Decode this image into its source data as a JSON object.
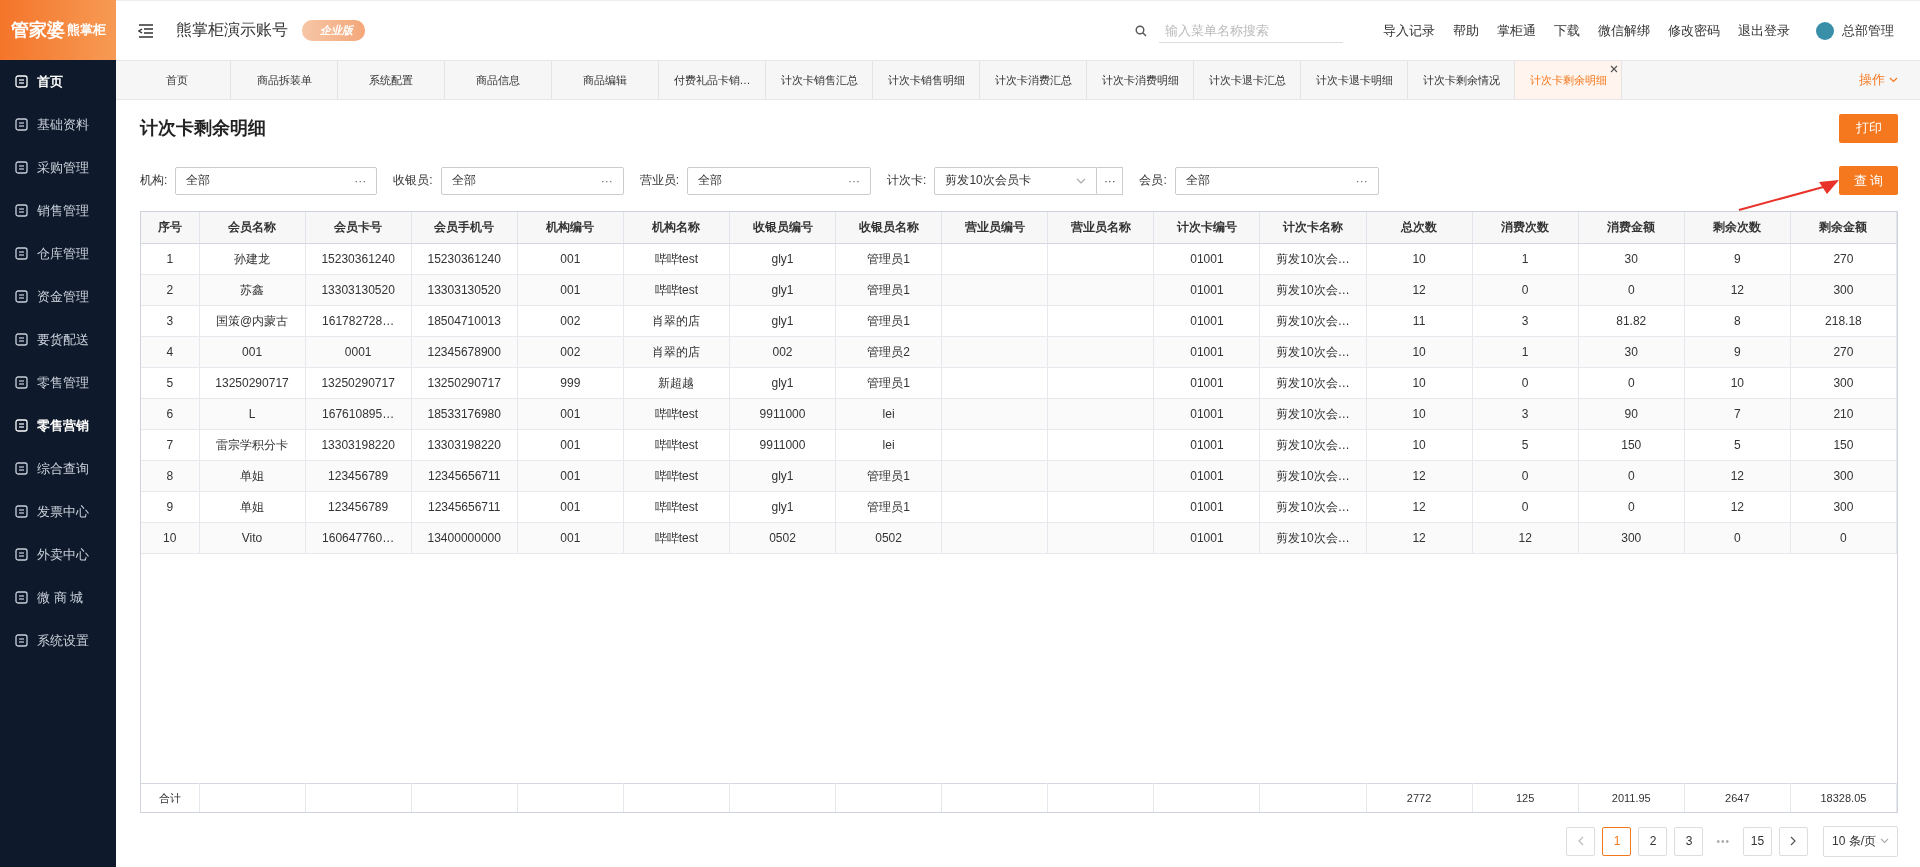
{
  "brand": {
    "name": "管家婆",
    "sub": "熊掌柜"
  },
  "sidebar": {
    "items": [
      {
        "label": "首页",
        "selected": true
      },
      {
        "label": "基础资料",
        "selected": false
      },
      {
        "label": "采购管理",
        "selected": false
      },
      {
        "label": "销售管理",
        "selected": false
      },
      {
        "label": "仓库管理",
        "selected": false
      },
      {
        "label": "资金管理",
        "selected": false
      },
      {
        "label": "要货配送",
        "selected": false
      },
      {
        "label": "零售管理",
        "selected": false
      },
      {
        "label": "零售营销",
        "selected": true
      },
      {
        "label": "综合查询",
        "selected": false
      },
      {
        "label": "发票中心",
        "selected": false
      },
      {
        "label": "外卖中心",
        "selected": false
      },
      {
        "label": "微 商 城",
        "selected": false
      },
      {
        "label": "系统设置",
        "selected": false
      }
    ]
  },
  "header": {
    "account": "熊掌柜演示账号",
    "edition_badge": "企业版",
    "search": {
      "placeholder": "输入菜单名称搜索"
    },
    "links": [
      "导入记录",
      "帮助",
      "掌柜通",
      "下载",
      "微信解绑",
      "修改密码",
      "退出登录"
    ],
    "user": "总部管理"
  },
  "tabs": [
    {
      "label": "首页",
      "selected": false,
      "closable": false
    },
    {
      "label": "商品拆装单",
      "selected": false,
      "closable": false
    },
    {
      "label": "系统配置",
      "selected": false,
      "closable": false
    },
    {
      "label": "商品信息",
      "selected": false,
      "closable": false
    },
    {
      "label": "商品编辑",
      "selected": false,
      "closable": false
    },
    {
      "label": "付费礼品卡销…",
      "selected": false,
      "closable": false
    },
    {
      "label": "计次卡销售汇总",
      "selected": false,
      "closable": false
    },
    {
      "label": "计次卡销售明细",
      "selected": false,
      "closable": false
    },
    {
      "label": "计次卡消费汇总",
      "selected": false,
      "closable": false
    },
    {
      "label": "计次卡消费明细",
      "selected": false,
      "closable": false
    },
    {
      "label": "计次卡退卡汇总",
      "selected": false,
      "closable": false
    },
    {
      "label": "计次卡退卡明细",
      "selected": false,
      "closable": false
    },
    {
      "label": "计次卡剩余情况",
      "selected": false,
      "closable": false
    },
    {
      "label": "计次卡剩余明细",
      "selected": true,
      "closable": true
    }
  ],
  "tab_actions": "操作",
  "page": {
    "title": "计次卡剩余明细",
    "print_button": "打印",
    "query_button": "查 询"
  },
  "filters": [
    {
      "label": "机构:",
      "value": "全部",
      "kind": "picker",
      "more": "···"
    },
    {
      "label": "收银员:",
      "value": "全部",
      "kind": "picker",
      "more": "···"
    },
    {
      "label": "营业员:",
      "value": "全部",
      "kind": "picker",
      "more": "···"
    },
    {
      "label": "计次卡:",
      "value": "剪发10次会员卡",
      "kind": "dropdown",
      "more": "···"
    },
    {
      "label": "会员:",
      "value": "全部",
      "kind": "picker",
      "more": "···"
    }
  ],
  "table": {
    "columns": [
      "序号",
      "会员名称",
      "会员卡号",
      "会员手机号",
      "机构编号",
      "机构名称",
      "收银员编号",
      "收银员名称",
      "营业员编号",
      "营业员名称",
      "计次卡编号",
      "计次卡名称",
      "总次数",
      "消费次数",
      "消费金额",
      "剩余次数",
      "剩余金额"
    ],
    "rows": [
      {
        "cells": [
          "1",
          "孙建龙",
          "15230361240",
          "15230361240",
          "001",
          "哔哔test",
          "gly1",
          "管理员1"
        ],
        "card_cells": [
          "01001",
          "剪发10次会…",
          "10",
          "1",
          "30",
          "9",
          "270"
        ]
      },
      {
        "cells": [
          "2",
          "苏鑫",
          "13303130520",
          "13303130520",
          "001",
          "哔哔test",
          "gly1",
          "管理员1"
        ],
        "card_cells": [
          "01001",
          "剪发10次会…",
          "12",
          "0",
          "0",
          "12",
          "300"
        ]
      },
      {
        "cells": [
          "3",
          "国策@内蒙古",
          "161782728…",
          "18504710013",
          "002",
          "肖翠的店",
          "gly1",
          "管理员1"
        ],
        "card_cells": [
          "01001",
          "剪发10次会…",
          "11",
          "3",
          "81.82",
          "8",
          "218.18"
        ]
      },
      {
        "cells": [
          "4",
          "001",
          "0001",
          "12345678900",
          "002",
          "肖翠的店",
          "002",
          "管理员2"
        ],
        "card_cells": [
          "01001",
          "剪发10次会…",
          "10",
          "1",
          "30",
          "9",
          "270"
        ]
      },
      {
        "cells": [
          "5",
          "13250290717",
          "13250290717",
          "13250290717",
          "999",
          "新超越",
          "gly1",
          "管理员1"
        ],
        "card_cells": [
          "01001",
          "剪发10次会…",
          "10",
          "0",
          "0",
          "10",
          "300"
        ]
      },
      {
        "cells": [
          "6",
          "L",
          "167610895…",
          "18533176980",
          "001",
          "哔哔test",
          "9911000",
          "lei"
        ],
        "card_cells": [
          "01001",
          "剪发10次会…",
          "10",
          "3",
          "90",
          "7",
          "210"
        ]
      },
      {
        "cells": [
          "7",
          "雷宗学积分卡",
          "13303198220",
          "13303198220",
          "001",
          "哔哔test",
          "9911000",
          "lei"
        ],
        "card_cells": [
          "01001",
          "剪发10次会…",
          "10",
          "5",
          "150",
          "5",
          "150"
        ]
      },
      {
        "cells": [
          "8",
          "单姐",
          "123456789",
          "12345656711",
          "001",
          "哔哔test",
          "gly1",
          "管理员1"
        ],
        "card_cells": [
          "01001",
          "剪发10次会…",
          "12",
          "0",
          "0",
          "12",
          "300"
        ]
      },
      {
        "cells": [
          "9",
          "单姐",
          "123456789",
          "12345656711",
          "001",
          "哔哔test",
          "gly1",
          "管理员1"
        ],
        "card_cells": [
          "01001",
          "剪发10次会…",
          "12",
          "0",
          "0",
          "12",
          "300"
        ]
      },
      {
        "cells": [
          "10",
          "Vito",
          "160647760…",
          "13400000000",
          "001",
          "哔哔test",
          "0502",
          "0502"
        ],
        "card_cells": [
          "01001",
          "剪发10次会…",
          "12",
          "12",
          "300",
          "0",
          "0"
        ]
      }
    ],
    "totals": {
      "label": "合计",
      "values": [
        "2772",
        "125",
        "2011.95",
        "2647",
        "18328.05"
      ]
    }
  },
  "pagination": {
    "pages": [
      {
        "label": "1",
        "selected": true
      },
      {
        "label": "2",
        "selected": false
      },
      {
        "label": "3",
        "selected": false
      }
    ],
    "ellipsis": "•••",
    "last_page": "15",
    "page_size": "10 条/页"
  }
}
